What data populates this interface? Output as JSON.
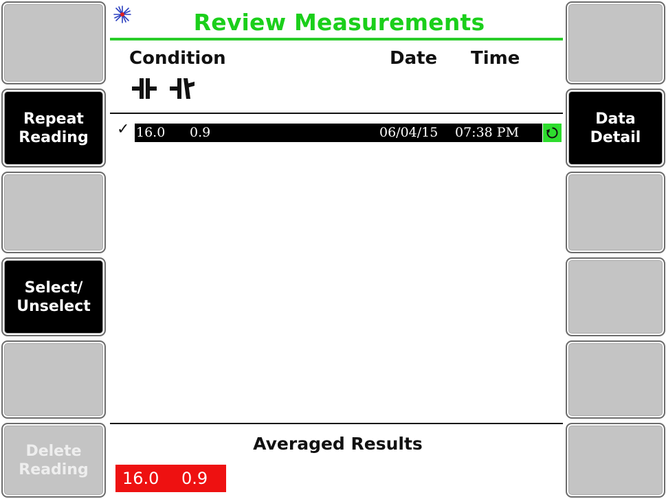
{
  "screen": {
    "title": "Review Measurements",
    "title_color": "#1bcf1b",
    "app_icon": "laser-burst-icon"
  },
  "columns": {
    "condition": "Condition",
    "date": "Date",
    "time": "Time",
    "condition_icons": [
      "angular-misalignment-icon",
      "offset-misalignment-icon"
    ]
  },
  "left_keys": [
    {
      "label": "",
      "state": "blank"
    },
    {
      "label": "Repeat\nReading",
      "line1": "Repeat",
      "line2": "Reading",
      "state": "active"
    },
    {
      "label": "",
      "state": "blank"
    },
    {
      "label": "Select/\nUnselect",
      "line1": "Select/",
      "line2": "Unselect",
      "state": "active"
    },
    {
      "label": "",
      "state": "blank"
    },
    {
      "label": "Delete\nReading",
      "line1": "Delete",
      "line2": "Reading",
      "state": "disabled"
    }
  ],
  "right_keys": [
    {
      "label": "",
      "state": "blank"
    },
    {
      "label": "Data\nDetail",
      "line1": "Data",
      "line2": "Detail",
      "state": "active"
    },
    {
      "label": "",
      "state": "blank"
    },
    {
      "label": "",
      "state": "blank"
    },
    {
      "label": "",
      "state": "blank"
    },
    {
      "label": "",
      "state": "blank"
    }
  ],
  "measurements": [
    {
      "selected": true,
      "check": "✓",
      "angular": "16.0",
      "offset": "0.9",
      "date": "06/04/15",
      "time": "07:38 PM",
      "status_icon": "restore-cycle-icon"
    }
  ],
  "averaged": {
    "title": "Averaged Results",
    "angular": "16.0",
    "offset": "0.9",
    "highlight_color": "#ee1111"
  }
}
